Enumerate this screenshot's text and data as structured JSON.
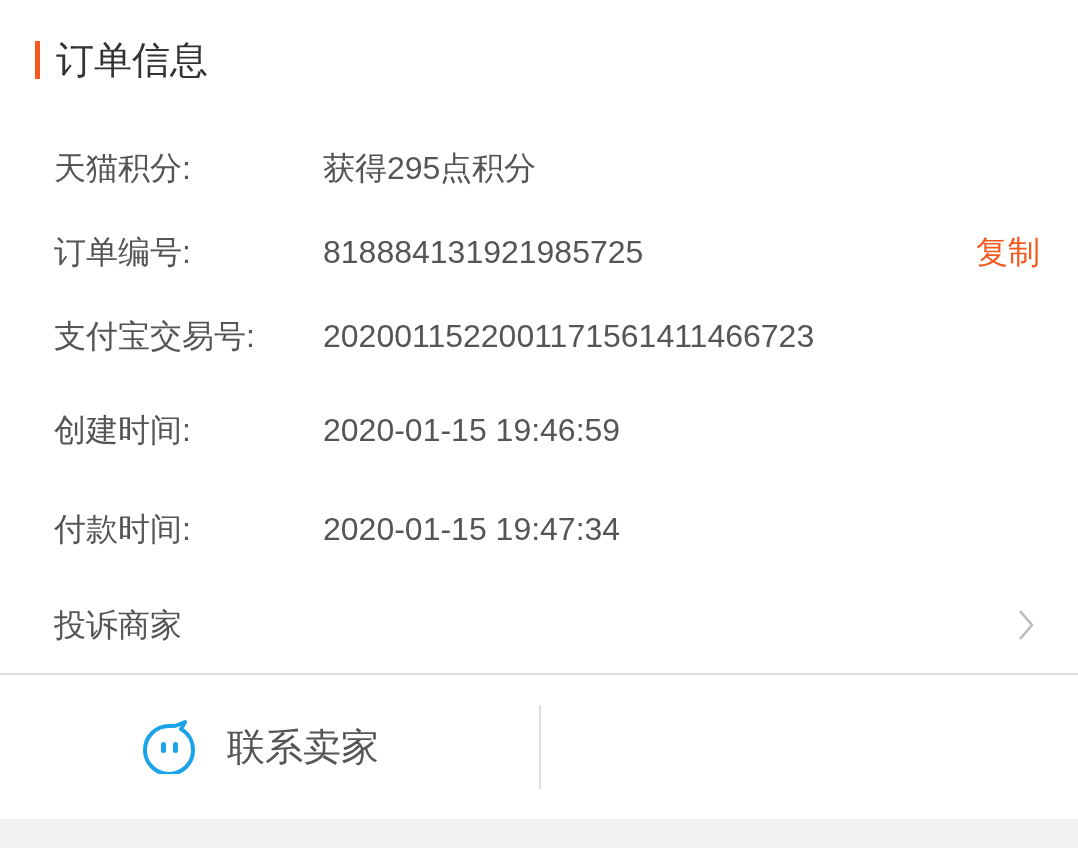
{
  "section_title": "订单信息",
  "info_rows": [
    {
      "label": "天猫积分:",
      "value": "获得295点积分"
    },
    {
      "label": "订单编号:",
      "value": "818884131921985725",
      "action": "复制"
    },
    {
      "label": "支付宝交易号:",
      "value": "2020011522001171561411466723"
    },
    {
      "label": "创建时间:",
      "value": "2020-01-15 19:46:59"
    },
    {
      "label": "付款时间:",
      "value": "2020-01-15 19:47:34"
    }
  ],
  "complaint_row": {
    "label": "投诉商家"
  },
  "footer": {
    "contact_button": "联系卖家"
  }
}
